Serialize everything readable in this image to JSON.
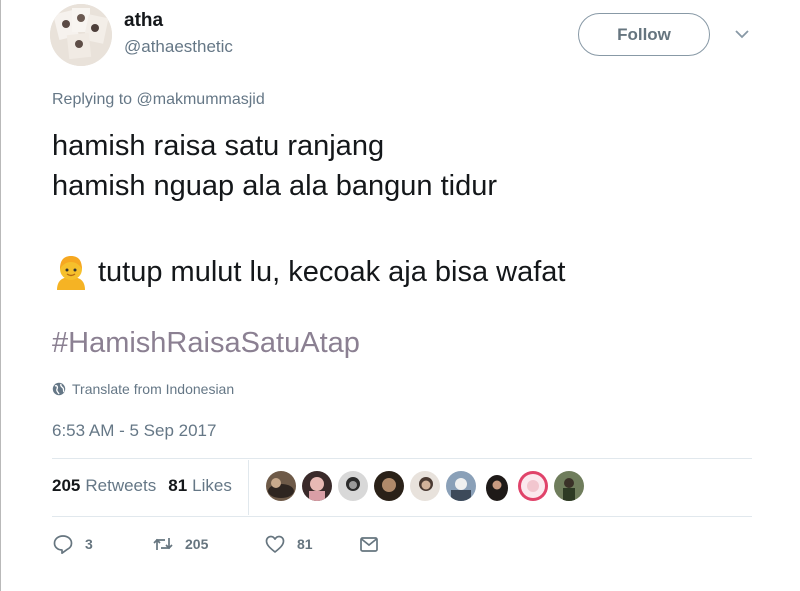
{
  "user": {
    "name": "atha",
    "handle": "@athaesthetic",
    "follow_label": "Follow"
  },
  "reply": {
    "prefix": "Replying to ",
    "handle": "@makmummasjid"
  },
  "tweet": {
    "line1": "hamish raisa satu ranjang",
    "line2": "hamish nguap ala ala bangun tidur",
    "line3": "tutup mulut lu, kecoak aja bisa wafat",
    "hashtag": "#HamishRaisaSatuAtap",
    "emoji": "person-blond-hair-icon"
  },
  "translate": {
    "label": "Translate from Indonesian"
  },
  "timestamp": "6:53 AM - 5 Sep 2017",
  "stats": {
    "retweets_count": "205",
    "retweets_label": "Retweets",
    "likes_count": "81",
    "likes_label": "Likes"
  },
  "actions": {
    "reply_count": "3",
    "retweet_count": "205",
    "like_count": "81"
  },
  "colors": {
    "hashtag": "#8b8092",
    "secondary_text": "#657786",
    "primary_text": "#14171a"
  }
}
